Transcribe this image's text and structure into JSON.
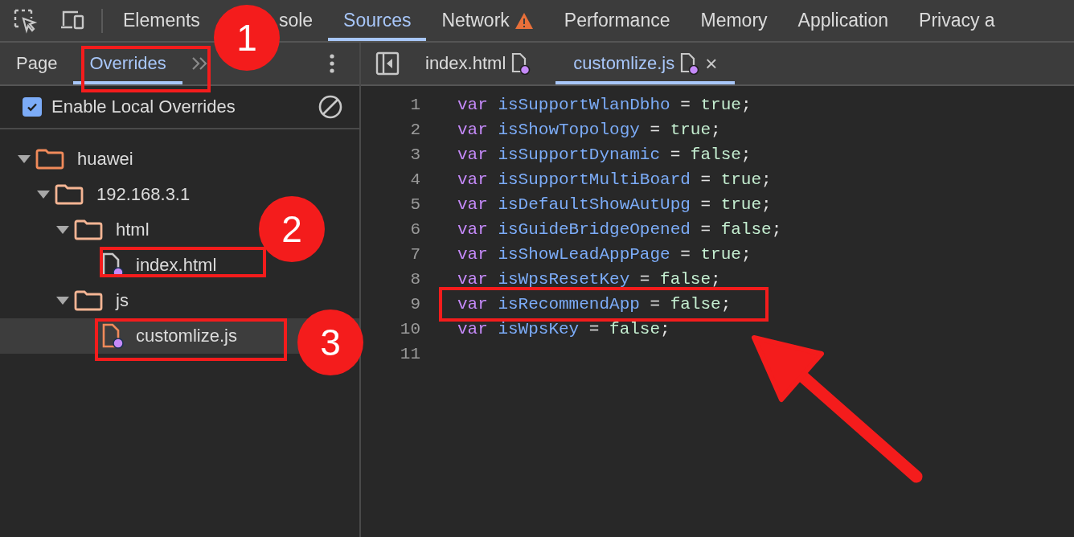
{
  "main_tabs": [
    {
      "label": "Elements",
      "selected": false
    },
    {
      "label": "sole",
      "selected": false,
      "partly_hidden": true
    },
    {
      "label": "Sources",
      "selected": true
    },
    {
      "label": "Network",
      "selected": false,
      "warning": true
    },
    {
      "label": "Performance",
      "selected": false
    },
    {
      "label": "Memory",
      "selected": false
    },
    {
      "label": "Application",
      "selected": false
    },
    {
      "label": "Privacy a",
      "selected": false
    }
  ],
  "sidebar": {
    "tabs": [
      {
        "label": "Page",
        "selected": false
      },
      {
        "label": "Overrides",
        "selected": true
      }
    ],
    "enable_overrides": {
      "label": "Enable Local Overrides",
      "checked": true
    },
    "tree": [
      {
        "name": "huawei",
        "kind": "folder",
        "expanded": true,
        "children": [
          {
            "name": "192.168.3.1",
            "kind": "folder",
            "expanded": true,
            "children": [
              {
                "name": "html",
                "kind": "folder",
                "expanded": true,
                "children": [
                  {
                    "name": "index.html",
                    "kind": "file",
                    "selected": false,
                    "modified": true
                  }
                ]
              },
              {
                "name": "js",
                "kind": "folder",
                "expanded": true,
                "children": [
                  {
                    "name": "customlize.js",
                    "kind": "file",
                    "selected": true,
                    "modified": true
                  }
                ]
              }
            ]
          }
        ]
      }
    ]
  },
  "editor": {
    "tabs": [
      {
        "label": "index.html",
        "selected": false,
        "modified": true
      },
      {
        "label": "customlize.js",
        "selected": true,
        "modified": true,
        "closable": "×"
      }
    ],
    "lines": [
      {
        "number": "1",
        "tokens": [
          {
            "text": "var",
            "kind": "keyword"
          },
          {
            "text": "isSupportWlanDbho",
            "kind": "name"
          },
          {
            "text": "=",
            "kind": "op"
          },
          {
            "text": "true",
            "kind": "literal"
          },
          {
            "text": ";",
            "kind": "op"
          }
        ]
      },
      {
        "number": "2",
        "tokens": [
          {
            "text": "var",
            "kind": "keyword"
          },
          {
            "text": "isShowTopology",
            "kind": "name"
          },
          {
            "text": "=",
            "kind": "op"
          },
          {
            "text": "true",
            "kind": "literal"
          },
          {
            "text": ";",
            "kind": "op"
          }
        ]
      },
      {
        "number": "3",
        "tokens": [
          {
            "text": "var",
            "kind": "keyword"
          },
          {
            "text": "isSupportDynamic",
            "kind": "name"
          },
          {
            "text": "=",
            "kind": "op"
          },
          {
            "text": "false",
            "kind": "literal"
          },
          {
            "text": ";",
            "kind": "op"
          }
        ]
      },
      {
        "number": "4",
        "tokens": [
          {
            "text": "var",
            "kind": "keyword"
          },
          {
            "text": "isSupportMultiBoard",
            "kind": "name"
          },
          {
            "text": "=",
            "kind": "op"
          },
          {
            "text": "true",
            "kind": "literal"
          },
          {
            "text": ";",
            "kind": "op"
          }
        ]
      },
      {
        "number": "5",
        "tokens": [
          {
            "text": "var",
            "kind": "keyword"
          },
          {
            "text": "isDefaultShowAutUpg",
            "kind": "name"
          },
          {
            "text": "=",
            "kind": "op"
          },
          {
            "text": "true",
            "kind": "literal"
          },
          {
            "text": ";",
            "kind": "op"
          }
        ]
      },
      {
        "number": "6",
        "tokens": [
          {
            "text": "var",
            "kind": "keyword"
          },
          {
            "text": "isGuideBridgeOpened",
            "kind": "name"
          },
          {
            "text": "=",
            "kind": "op"
          },
          {
            "text": "false",
            "kind": "literal"
          },
          {
            "text": ";",
            "kind": "op"
          }
        ]
      },
      {
        "number": "7",
        "tokens": [
          {
            "text": "var",
            "kind": "keyword"
          },
          {
            "text": "isShowLeadAppPage",
            "kind": "name"
          },
          {
            "text": "=",
            "kind": "op"
          },
          {
            "text": "true",
            "kind": "literal"
          },
          {
            "text": ";",
            "kind": "op"
          }
        ]
      },
      {
        "number": "8",
        "tokens": [
          {
            "text": "var",
            "kind": "keyword"
          },
          {
            "text": "isWpsResetKey",
            "kind": "name"
          },
          {
            "text": "=",
            "kind": "op"
          },
          {
            "text": "false",
            "kind": "literal"
          },
          {
            "text": ";",
            "kind": "op"
          }
        ]
      },
      {
        "number": "9",
        "tokens": [
          {
            "text": "var",
            "kind": "keyword"
          },
          {
            "text": "isRecommendApp",
            "kind": "name"
          },
          {
            "text": "=",
            "kind": "op"
          },
          {
            "text": "false",
            "kind": "literal"
          },
          {
            "text": ";",
            "kind": "op"
          }
        ]
      },
      {
        "number": "10",
        "tokens": [
          {
            "text": "var",
            "kind": "keyword"
          },
          {
            "text": "isWpsKey",
            "kind": "name"
          },
          {
            "text": "=",
            "kind": "op"
          },
          {
            "text": "false",
            "kind": "literal"
          },
          {
            "text": ";",
            "kind": "op"
          }
        ]
      },
      {
        "number": "11"
      }
    ]
  },
  "annotations": {
    "badges": [
      {
        "label": "1"
      },
      {
        "label": "2"
      },
      {
        "label": "3"
      }
    ]
  }
}
